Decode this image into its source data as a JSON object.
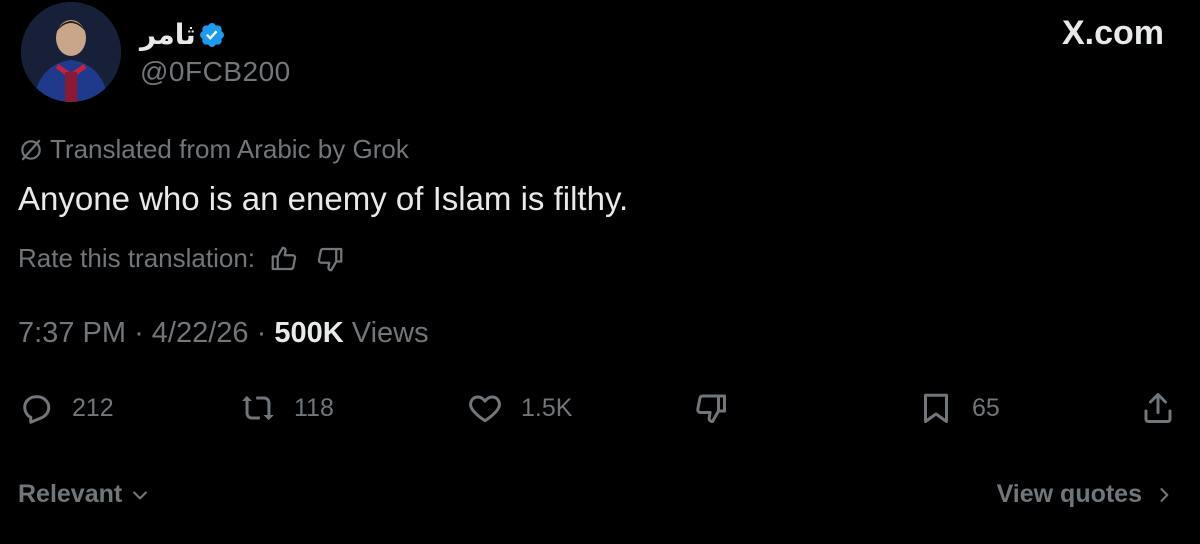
{
  "author": {
    "display_name": "ثامر",
    "handle": "@0FCB200",
    "verified": true
  },
  "site_mark": "X.com",
  "translation": {
    "label": "Translated from Arabic by Grok",
    "rate_label": "Rate this translation:"
  },
  "tweet": {
    "text": "Anyone who is an enemy of Islam is filthy."
  },
  "meta": {
    "time": "7:37 PM",
    "separator": "·",
    "date": "4/22/26",
    "views_count": "500K",
    "views_label": "Views"
  },
  "actions": {
    "replies": "212",
    "reposts": "118",
    "likes": "1.5K",
    "bookmarks": "65"
  },
  "footer": {
    "sort_label": "Relevant",
    "view_quotes_label": "View quotes"
  },
  "colors": {
    "background": "#000000",
    "primary_text": "#e7e9ea",
    "secondary_text": "#71767b",
    "verified_badge": "#1d9bf0"
  },
  "icons": [
    "verified-badge-icon",
    "grok-slash-icon",
    "thumbs-up-icon",
    "thumbs-down-icon",
    "reply-icon",
    "repost-icon",
    "like-icon",
    "downvote-icon",
    "bookmark-icon",
    "share-icon",
    "chevron-down-icon",
    "chevron-right-icon"
  ]
}
